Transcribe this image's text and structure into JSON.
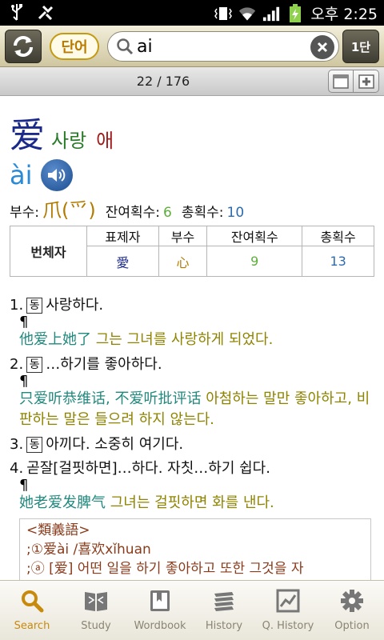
{
  "status_bar": {
    "time": "오후 2:25"
  },
  "toolbar": {
    "mode_label": "단어",
    "search_value": "ai",
    "page_label": "1단"
  },
  "counter": "22 / 176",
  "entry": {
    "hanzi": "爱",
    "meaning": "사랑",
    "sound": "애",
    "pinyin": "ài",
    "radical_label": "부수:",
    "radical": "爪(爫)",
    "remaining_strokes_label": "잔여획수:",
    "remaining_strokes": "6",
    "total_strokes_label": "총획수:",
    "total_strokes": "10"
  },
  "variant_table": {
    "row_label": "번체자",
    "headers": [
      "표제자",
      "부수",
      "잔여획수",
      "총획수"
    ],
    "values": [
      "愛",
      "心",
      "9",
      "13"
    ]
  },
  "definitions": [
    {
      "num": "1.",
      "pos": "동",
      "text": "사랑하다.",
      "pilcrow": "¶",
      "example_zh": "他爱上她了",
      "example_ko": "그는 그녀를 사랑하게 되었다."
    },
    {
      "num": "2.",
      "pos": "동",
      "text": "…하기를 좋아하다.",
      "pilcrow": "¶",
      "example_zh": "只爱听恭维话, 不爱听批评话",
      "example_ko": "아첨하는 말만 좋아하고, 비판하는 말은 들으려 하지 않는다."
    },
    {
      "num": "3.",
      "pos": "동",
      "text": "아끼다. 소중히 여기다."
    },
    {
      "num": "4.",
      "text": "곧잘[걸핏하면]…하다. 자칫…하기 쉽다.",
      "pilcrow": "¶",
      "example_zh": "她老爱发脾气",
      "example_ko": "그녀는 걸핏하면 화를 낸다."
    }
  ],
  "synonyms": {
    "title": "<類義語>",
    "line1": ";①爱ài /喜欢xǐhuan",
    "line2": ";ⓐ [爱] 어떤 일을 하기 좋아하고 또한 그것을 자"
  },
  "bottom_nav": [
    {
      "label": "Search",
      "icon": "search-icon"
    },
    {
      "label": "Study",
      "icon": "book-icon"
    },
    {
      "label": "Wordbook",
      "icon": "wordbook-icon"
    },
    {
      "label": "History",
      "icon": "history-icon"
    },
    {
      "label": "Q. History",
      "icon": "chart-icon"
    },
    {
      "label": "Option",
      "icon": "gear-icon"
    }
  ],
  "colors": {
    "accent": "#c88a0c",
    "hanzi": "#1b2a8a",
    "pinyin": "#2a8ad6"
  }
}
